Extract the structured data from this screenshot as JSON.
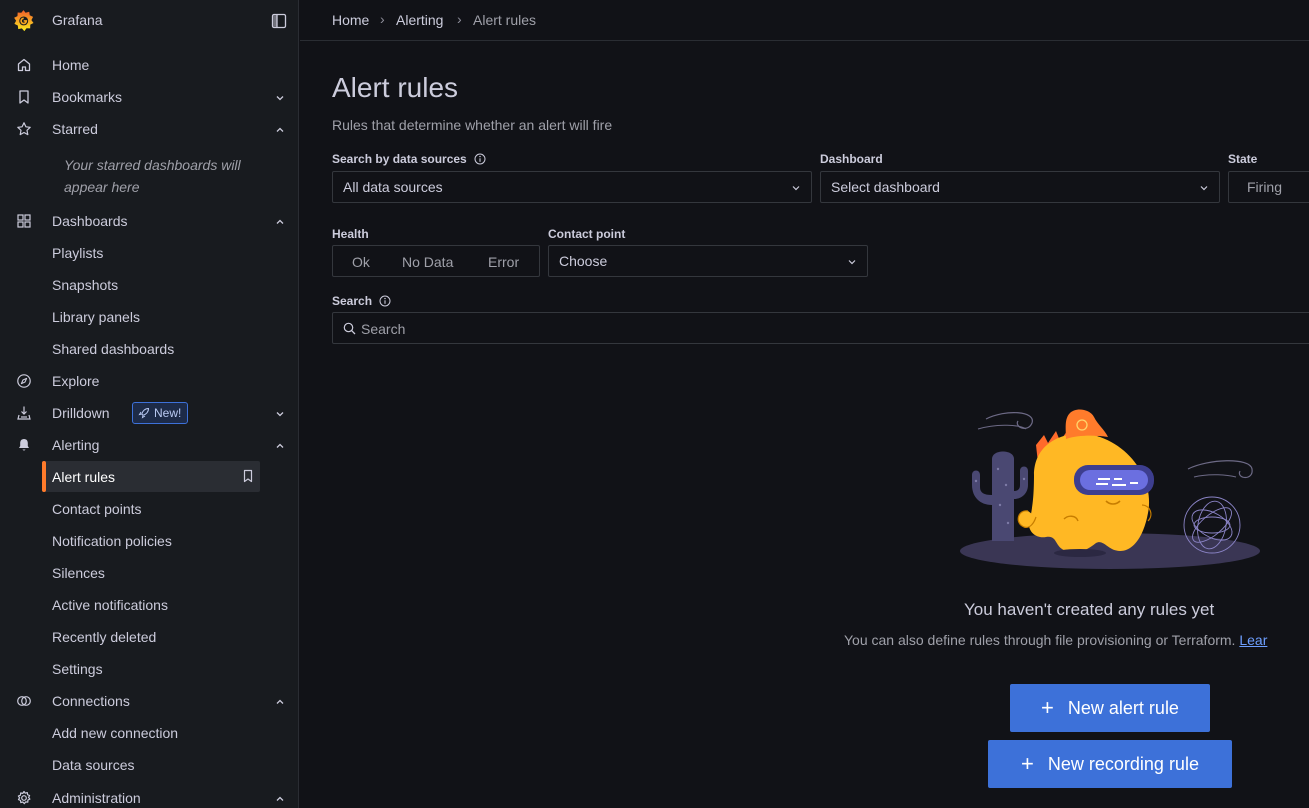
{
  "app": {
    "name": "Grafana"
  },
  "breadcrumb": [
    "Home",
    "Alerting",
    "Alert rules"
  ],
  "sidebar": {
    "items": [
      {
        "label": "Home",
        "icon": "home-icon"
      },
      {
        "label": "Bookmarks",
        "icon": "bookmark-icon"
      },
      {
        "label": "Starred",
        "icon": "star-icon"
      },
      {
        "label": "Dashboards",
        "icon": "dashboards-icon"
      },
      {
        "label": "Playlists"
      },
      {
        "label": "Snapshots"
      },
      {
        "label": "Library panels"
      },
      {
        "label": "Shared dashboards"
      },
      {
        "label": "Explore",
        "icon": "compass-icon"
      },
      {
        "label": "Drilldown",
        "icon": "drilldown-icon"
      },
      {
        "label": "Alerting",
        "icon": "bell-icon"
      },
      {
        "label": "Alert rules"
      },
      {
        "label": "Contact points"
      },
      {
        "label": "Notification policies"
      },
      {
        "label": "Silences"
      },
      {
        "label": "Active notifications"
      },
      {
        "label": "Recently deleted"
      },
      {
        "label": "Settings"
      },
      {
        "label": "Connections",
        "icon": "connections-icon"
      },
      {
        "label": "Add new connection"
      },
      {
        "label": "Data sources"
      },
      {
        "label": "Administration",
        "icon": "cog-icon"
      }
    ],
    "starred_empty": "Your starred dashboards will appear here",
    "new_badge": "New!"
  },
  "page": {
    "title": "Alert rules",
    "subtitle": "Rules that determine whether an alert will fire"
  },
  "filters": {
    "datasource_label": "Search by data sources",
    "datasource_value": "All data sources",
    "dashboard_label": "Dashboard",
    "dashboard_value": "Select dashboard",
    "state_label": "State",
    "state_value": "Firing",
    "health_label": "Health",
    "health_options": [
      "Ok",
      "No Data",
      "Error"
    ],
    "contact_label": "Contact point",
    "contact_value": "Choose",
    "search_label": "Search",
    "search_placeholder": "Search"
  },
  "empty": {
    "title": "You haven't created any rules yet",
    "description": "You can also define rules through file provisioning or Terraform.",
    "link": "Lear"
  },
  "actions": {
    "new_alert_rule": "New alert rule",
    "new_recording_rule": "New recording rule"
  },
  "colors": {
    "accent": "#3d71d9",
    "active_bar": "#ff7b2b",
    "background": "#111217",
    "sidebar": "#181b1f"
  }
}
